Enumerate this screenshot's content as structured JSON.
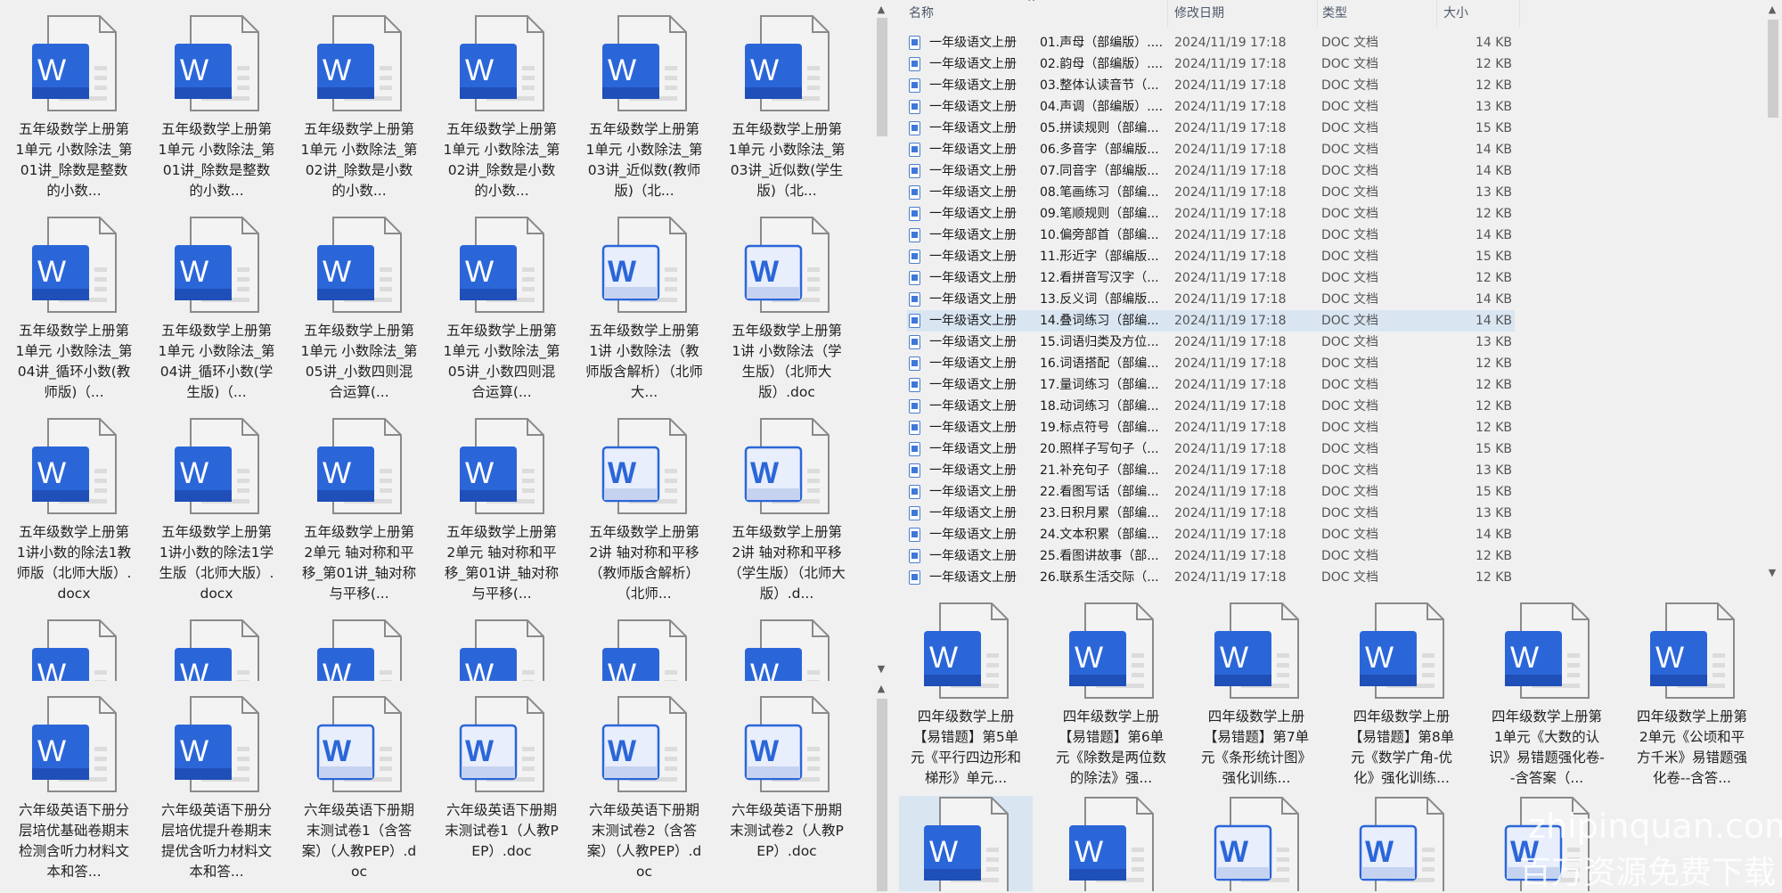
{
  "left_grid": {
    "rows": [
      [
        {
          "label": "五年级数学上册第1单元 小数除法_第01讲_除数是整数的小数...",
          "variant": "solid"
        },
        {
          "label": "五年级数学上册第1单元 小数除法_第01讲_除数是整数的小数...",
          "variant": "solid"
        },
        {
          "label": "五年级数学上册第1单元 小数除法_第02讲_除数是小数的小数...",
          "variant": "solid"
        },
        {
          "label": "五年级数学上册第1单元 小数除法_第02讲_除数是小数的小数...",
          "variant": "solid"
        },
        {
          "label": "五年级数学上册第1单元 小数除法_第03讲_近似数(教师版)（北...",
          "variant": "solid"
        },
        {
          "label": "五年级数学上册第1单元 小数除法_第03讲_近似数(学生版)（北...",
          "variant": "solid"
        }
      ],
      [
        {
          "label": "五年级数学上册第1单元 小数除法_第04讲_循环小数(教师版)（...",
          "variant": "solid"
        },
        {
          "label": "五年级数学上册第1单元 小数除法_第04讲_循环小数(学生版)（...",
          "variant": "solid"
        },
        {
          "label": "五年级数学上册第1单元 小数除法_第05讲_小数四则混合运算(...",
          "variant": "solid"
        },
        {
          "label": "五年级数学上册第1单元 小数除法_第05讲_小数四则混合运算(...",
          "variant": "solid"
        },
        {
          "label": "五年级数学上册第1讲 小数除法（教师版含解析）（北师大...",
          "variant": "light"
        },
        {
          "label": "五年级数学上册第1讲 小数除法（学生版）（北师大版）.doc",
          "variant": "light"
        }
      ],
      [
        {
          "label": "五年级数学上册第1讲小数的除法1教师版（北师大版）.docx",
          "variant": "solid"
        },
        {
          "label": "五年级数学上册第1讲小数的除法1学生版（北师大版）.docx",
          "variant": "solid"
        },
        {
          "label": "五年级数学上册第2单元 轴对称和平移_第01讲_轴对称与平移(...",
          "variant": "solid"
        },
        {
          "label": "五年级数学上册第2单元 轴对称和平移_第01讲_轴对称与平移(...",
          "variant": "solid"
        },
        {
          "label": "五年级数学上册第2讲 轴对称和平移（教师版含解析）（北师...",
          "variant": "light"
        },
        {
          "label": "五年级数学上册第2讲 轴对称和平移（学生版）（北师大版）.d...",
          "variant": "light"
        }
      ]
    ],
    "cut_row_variants": [
      "solid",
      "solid",
      "solid",
      "solid",
      "solid",
      "solid"
    ],
    "bottom_row": [
      {
        "label": "六年级英语下册分层培优基础卷期末检测含听力材料文本和答...",
        "variant": "solid"
      },
      {
        "label": "六年级英语下册分层培优提升卷期末提优含听力材料文本和答...",
        "variant": "solid"
      },
      {
        "label": "六年级英语下册期末测试卷1（含答案）（人教PEP）.doc",
        "variant": "light"
      },
      {
        "label": "六年级英语下册期末测试卷1（人教PEP）.doc",
        "variant": "light"
      },
      {
        "label": "六年级英语下册期末测试卷2（含答案）（人教PEP）.doc",
        "variant": "light"
      },
      {
        "label": "六年级英语下册期末测试卷2（人教PEP）.doc",
        "variant": "light"
      }
    ]
  },
  "list": {
    "headers": {
      "name": "名称",
      "date": "修改日期",
      "type": "类型",
      "size": "大小",
      "sort_indicator": "^"
    },
    "selected_index": 13,
    "rows": [
      {
        "name": "一年级语文上册",
        "sub": "01.声母（部编版）....",
        "date": "2024/11/19 17:18",
        "type": "DOC 文档",
        "size": "14 KB"
      },
      {
        "name": "一年级语文上册",
        "sub": "02.韵母（部编版）....",
        "date": "2024/11/19 17:18",
        "type": "DOC 文档",
        "size": "12 KB"
      },
      {
        "name": "一年级语文上册",
        "sub": "03.整体认读音节（...",
        "date": "2024/11/19 17:18",
        "type": "DOC 文档",
        "size": "12 KB"
      },
      {
        "name": "一年级语文上册",
        "sub": "04.声调（部编版）....",
        "date": "2024/11/19 17:18",
        "type": "DOC 文档",
        "size": "13 KB"
      },
      {
        "name": "一年级语文上册",
        "sub": "05.拼读规则（部编...",
        "date": "2024/11/19 17:18",
        "type": "DOC 文档",
        "size": "15 KB"
      },
      {
        "name": "一年级语文上册",
        "sub": "06.多音字（部编版...",
        "date": "2024/11/19 17:18",
        "type": "DOC 文档",
        "size": "14 KB"
      },
      {
        "name": "一年级语文上册",
        "sub": "07.同音字（部编版...",
        "date": "2024/11/19 17:18",
        "type": "DOC 文档",
        "size": "14 KB"
      },
      {
        "name": "一年级语文上册",
        "sub": "08.笔画练习（部编...",
        "date": "2024/11/19 17:18",
        "type": "DOC 文档",
        "size": "13 KB"
      },
      {
        "name": "一年级语文上册",
        "sub": "09.笔顺规则（部编...",
        "date": "2024/11/19 17:18",
        "type": "DOC 文档",
        "size": "12 KB"
      },
      {
        "name": "一年级语文上册",
        "sub": "10.偏旁部首（部编...",
        "date": "2024/11/19 17:18",
        "type": "DOC 文档",
        "size": "14 KB"
      },
      {
        "name": "一年级语文上册",
        "sub": "11.形近字（部编版...",
        "date": "2024/11/19 17:18",
        "type": "DOC 文档",
        "size": "15 KB"
      },
      {
        "name": "一年级语文上册",
        "sub": "12.看拼音写汉字（...",
        "date": "2024/11/19 17:18",
        "type": "DOC 文档",
        "size": "12 KB"
      },
      {
        "name": "一年级语文上册",
        "sub": "13.反义词（部编版...",
        "date": "2024/11/19 17:18",
        "type": "DOC 文档",
        "size": "14 KB"
      },
      {
        "name": "一年级语文上册",
        "sub": "14.叠词练习（部编...",
        "date": "2024/11/19 17:18",
        "type": "DOC 文档",
        "size": "14 KB"
      },
      {
        "name": "一年级语文上册",
        "sub": "15.词语归类及方位...",
        "date": "2024/11/19 17:18",
        "type": "DOC 文档",
        "size": "13 KB"
      },
      {
        "name": "一年级语文上册",
        "sub": "16.词语搭配（部编...",
        "date": "2024/11/19 17:18",
        "type": "DOC 文档",
        "size": "12 KB"
      },
      {
        "name": "一年级语文上册",
        "sub": "17.量词练习（部编...",
        "date": "2024/11/19 17:18",
        "type": "DOC 文档",
        "size": "12 KB"
      },
      {
        "name": "一年级语文上册",
        "sub": "18.动词练习（部编...",
        "date": "2024/11/19 17:18",
        "type": "DOC 文档",
        "size": "12 KB"
      },
      {
        "name": "一年级语文上册",
        "sub": "19.标点符号（部编...",
        "date": "2024/11/19 17:18",
        "type": "DOC 文档",
        "size": "12 KB"
      },
      {
        "name": "一年级语文上册",
        "sub": "20.照样子写句子（...",
        "date": "2024/11/19 17:18",
        "type": "DOC 文档",
        "size": "15 KB"
      },
      {
        "name": "一年级语文上册",
        "sub": "21.补充句子（部编...",
        "date": "2024/11/19 17:18",
        "type": "DOC 文档",
        "size": "13 KB"
      },
      {
        "name": "一年级语文上册",
        "sub": "22.看图写话（部编...",
        "date": "2024/11/19 17:18",
        "type": "DOC 文档",
        "size": "15 KB"
      },
      {
        "name": "一年级语文上册",
        "sub": "23.日积月累（部编...",
        "date": "2024/11/19 17:18",
        "type": "DOC 文档",
        "size": "13 KB"
      },
      {
        "name": "一年级语文上册",
        "sub": "24.文本积累（部编...",
        "date": "2024/11/19 17:18",
        "type": "DOC 文档",
        "size": "14 KB"
      },
      {
        "name": "一年级语文上册",
        "sub": "25.看图讲故事（部...",
        "date": "2024/11/19 17:18",
        "type": "DOC 文档",
        "size": "12 KB"
      },
      {
        "name": "一年级语文上册",
        "sub": "26.联系生活交际（...",
        "date": "2024/11/19 17:18",
        "type": "DOC 文档",
        "size": "12 KB"
      }
    ]
  },
  "right_grid": {
    "top_row": [
      {
        "label": "四年级数学上册【易错题】第5单元《平行四边形和梯形》单元...",
        "variant": "solid"
      },
      {
        "label": "四年级数学上册【易错题】第6单元《除数是两位数的除法》强...",
        "variant": "solid"
      },
      {
        "label": "四年级数学上册【易错题】第7单元《条形统计图》强化训练...",
        "variant": "solid"
      },
      {
        "label": "四年级数学上册【易错题】第8单元《数学广角-优化》强化训练...",
        "variant": "solid"
      },
      {
        "label": "四年级数学上册第1单元《大数的认识》易错题强化卷--含答案（...",
        "variant": "solid"
      },
      {
        "label": "四年级数学上册第2单元《公顷和平方千米》易错题强化卷--含答...",
        "variant": "solid"
      }
    ],
    "cut_row_variants": [
      "solid",
      "solid",
      "light",
      "light",
      "light"
    ]
  },
  "watermark": {
    "line1": "zhipinquan.com",
    "line2": "百万资源免费下载"
  },
  "colors": {
    "word_blue": "#2b66d9",
    "word_dark": "#1f4fb8",
    "page_stroke": "#8a8a8a",
    "selection": "#d9e6f2"
  }
}
